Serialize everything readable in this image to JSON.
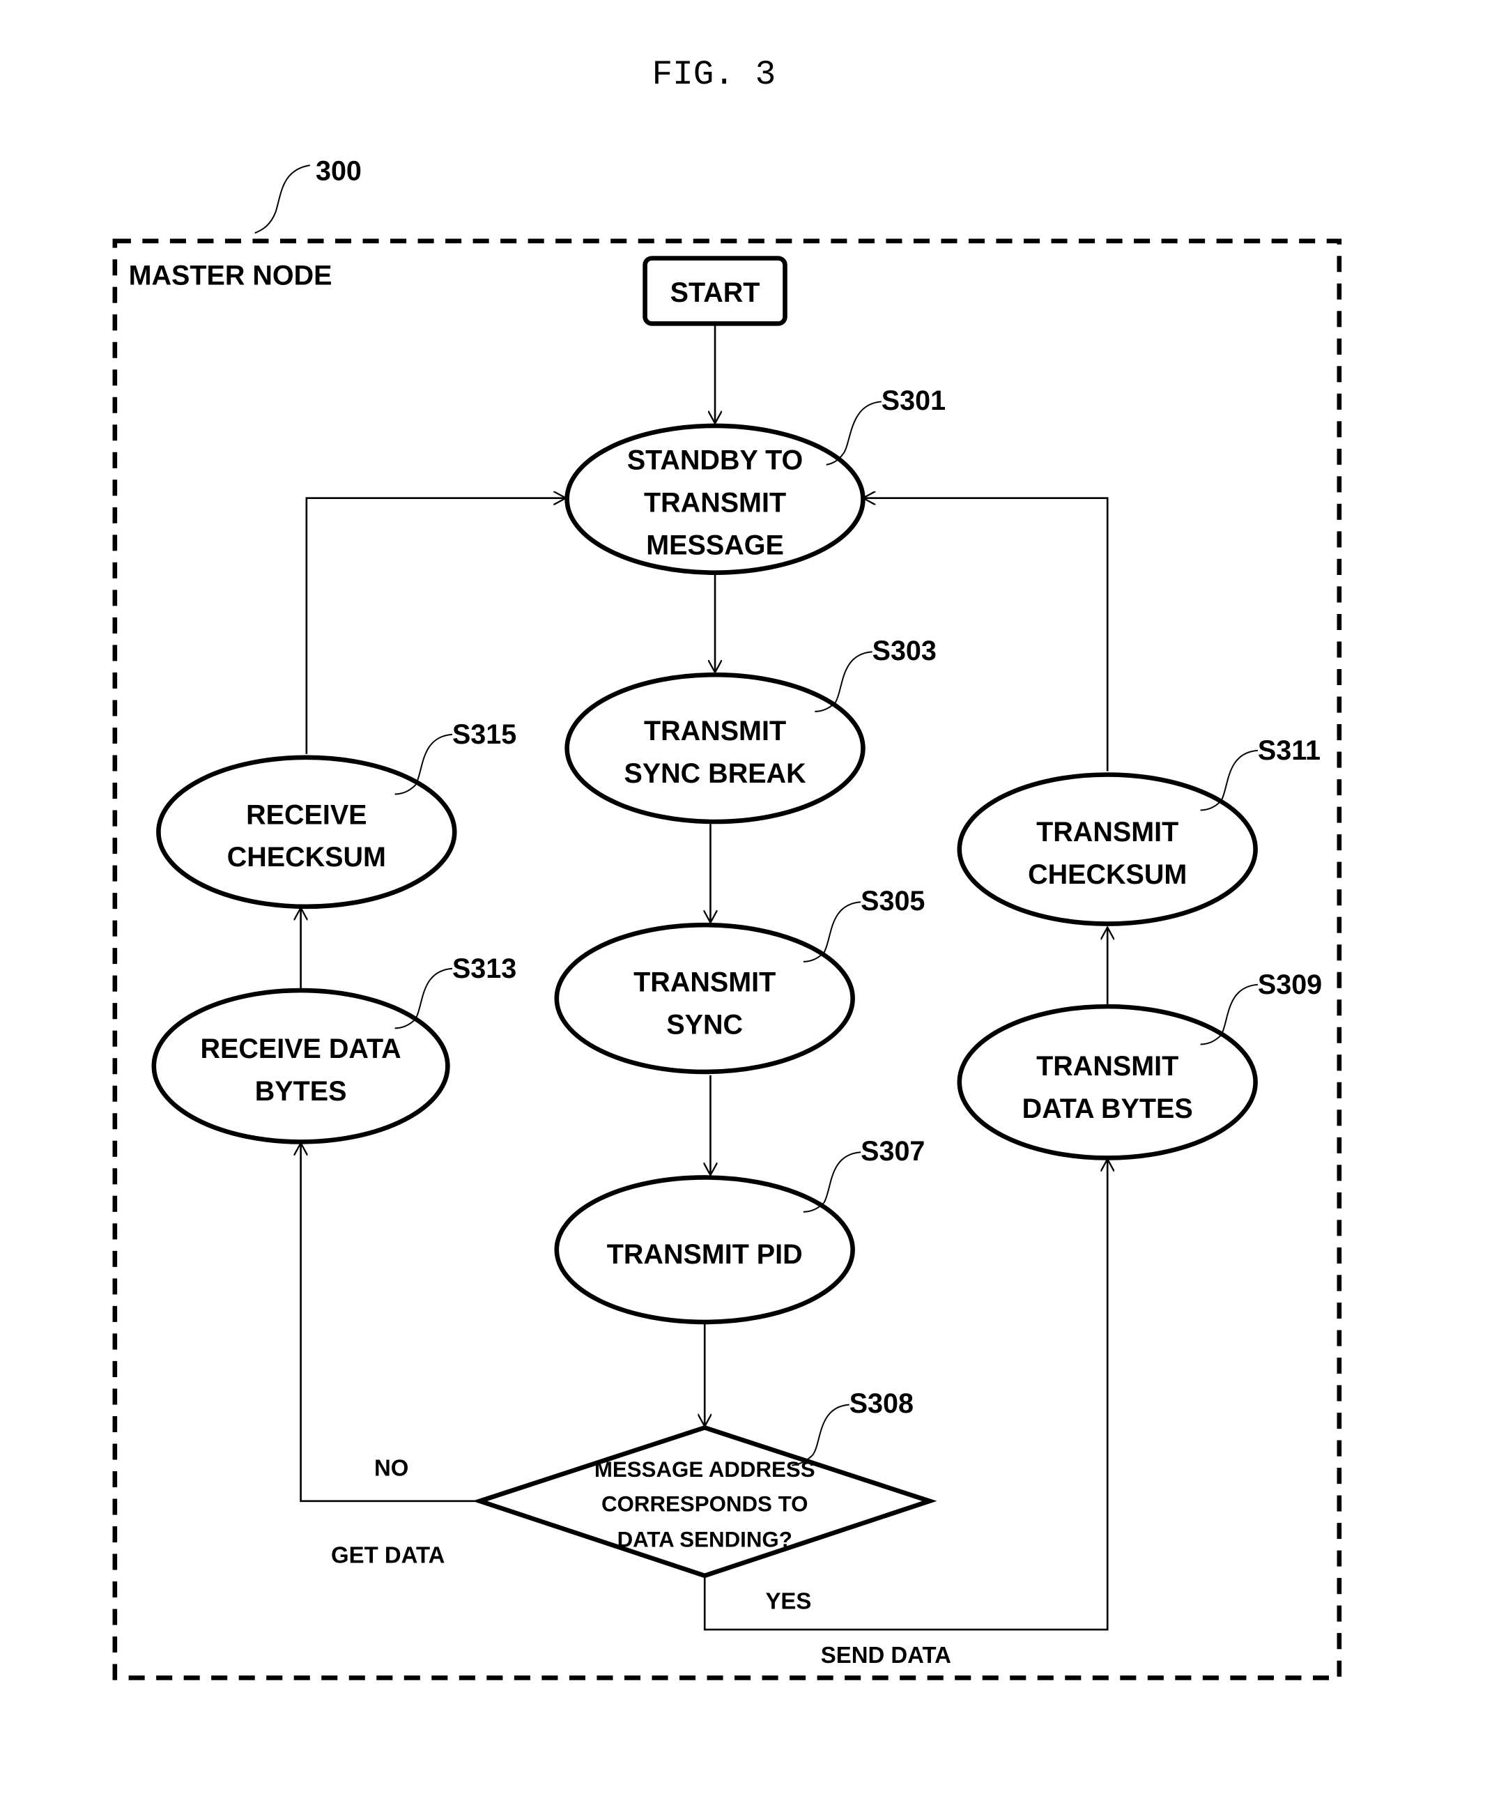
{
  "figure": {
    "title": "FIG. 3",
    "reference": "300",
    "container_label": "MASTER NODE"
  },
  "nodes": {
    "start": {
      "label": "START"
    },
    "s301": {
      "id": "S301",
      "lines": [
        "STANDBY TO",
        "TRANSMIT",
        "MESSAGE"
      ]
    },
    "s303": {
      "id": "S303",
      "lines": [
        "TRANSMIT",
        "SYNC BREAK"
      ]
    },
    "s305": {
      "id": "S305",
      "lines": [
        "TRANSMIT",
        "SYNC"
      ]
    },
    "s307": {
      "id": "S307",
      "lines": [
        "TRANSMIT PID"
      ]
    },
    "s308": {
      "id": "S308",
      "lines": [
        "MESSAGE ADDRESS",
        "CORRESPONDS TO",
        "DATA SENDING?"
      ]
    },
    "s309": {
      "id": "S309",
      "lines": [
        "TRANSMIT",
        "DATA BYTES"
      ]
    },
    "s311": {
      "id": "S311",
      "lines": [
        "TRANSMIT",
        "CHECKSUM"
      ]
    },
    "s313": {
      "id": "S313",
      "lines": [
        "RECEIVE DATA",
        "BYTES"
      ]
    },
    "s315": {
      "id": "S315",
      "lines": [
        "RECEIVE",
        "CHECKSUM"
      ]
    }
  },
  "edges": {
    "no_label": "NO",
    "get_data_label": "GET DATA",
    "yes_label": "YES",
    "send_data_label": "SEND DATA"
  }
}
